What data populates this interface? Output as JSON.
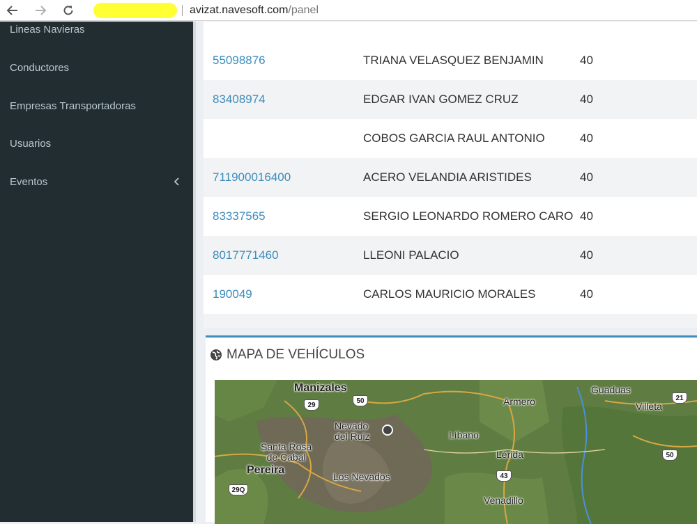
{
  "browser": {
    "url_host": "avizat.navesoft.com",
    "url_path": "/panel"
  },
  "sidebar": {
    "items": [
      {
        "label": "Lineas Navieras"
      },
      {
        "label": "Conductores"
      },
      {
        "label": "Empresas Transportadoras"
      },
      {
        "label": "Usuarios"
      },
      {
        "label": "Eventos"
      }
    ]
  },
  "table": {
    "rows": [
      {
        "id": "55098876",
        "name": "TRIANA VELASQUEZ BENJAMIN",
        "value": "40"
      },
      {
        "id": "83408974",
        "name": "EDGAR IVAN GOMEZ CRUZ",
        "value": "40"
      },
      {
        "id": "",
        "name": "COBOS GARCIA RAUL ANTONIO",
        "value": "40"
      },
      {
        "id": "711900016400",
        "name": "ACERO VELANDIA ARISTIDES",
        "value": "40"
      },
      {
        "id": "83337565",
        "name": "SERGIO LEONARDO ROMERO CARO",
        "value": "40"
      },
      {
        "id": "8017771460",
        "name": "LLEONI PALACIO",
        "value": "40"
      },
      {
        "id": "190049",
        "name": "CARLOS MAURICIO MORALES",
        "value": "40"
      }
    ]
  },
  "map_panel": {
    "title": "MAPA DE VEHÍCULOS",
    "places": {
      "manizales": "Manizales",
      "armero": "Armero",
      "guaduas": "Guaduas",
      "villeta": "Villeta",
      "nevado_ruiz": "Nevado\ndel Ruiz",
      "santa_rosa": "Santa Rosa\nde Cabal",
      "libano": "Líbano",
      "lerida": "Lérida",
      "pereira": "Pereira",
      "los_nevados": "Los Nevados",
      "venadillo": "Venadillo"
    },
    "routes": {
      "r29": "29",
      "r50a": "50",
      "r21": "21",
      "r50b": "50",
      "r43": "43",
      "r29q": "29Q"
    }
  }
}
